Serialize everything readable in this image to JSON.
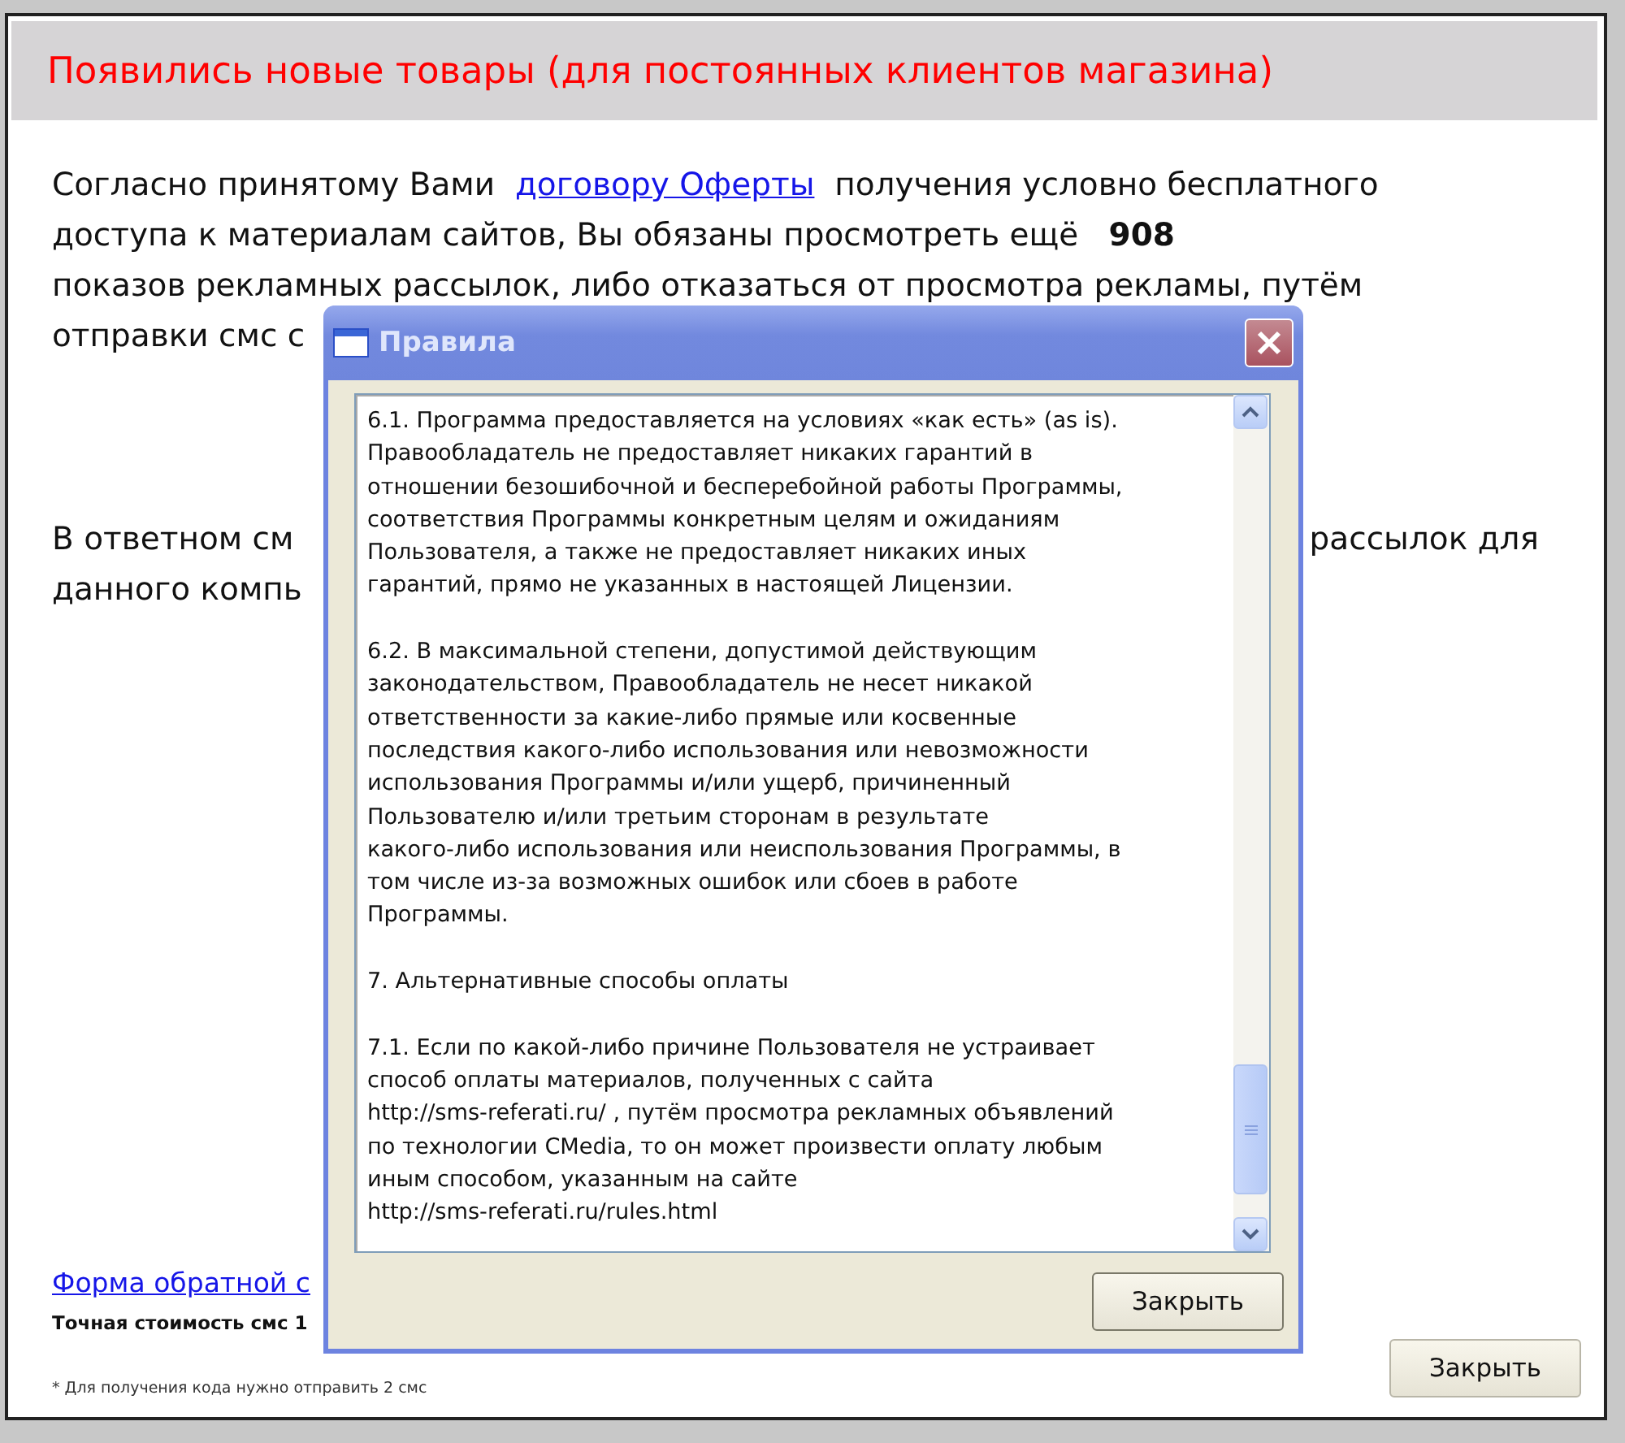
{
  "main_window": {
    "heading": "Появились новые товары (для постоянных клиентов магазина)",
    "offer": {
      "before": "Согласно принятому Вами",
      "link": "договору Оферты",
      "after": "получения условно бесплатного",
      "line2": "доступа к материалам сайтов, Вы обязаны просмотреть ещё",
      "count": "908",
      "line3": "показов рекламных рассылок, либо отказаться от просмотра рекламы, путём",
      "line4": "отправки смс с"
    },
    "reply": {
      "line1_left": "В ответном см",
      "line1_right": "рассылок для",
      "line2": "данного компь"
    },
    "feedback_link": "Форма обратной с",
    "price_note": "Точная стоимость смс 1",
    "footnote": "* Для получения кода нужно отправить 2 смс",
    "close_button": "Закрыть"
  },
  "dialog": {
    "title": "Правила",
    "paragraphs": [
      {
        "lines": [
          "6.1. Программа предоставляется на условиях «как есть» (as is).",
          "Правообладатель не предоставляет никаких гарантий в",
          "отношении безошибочной и бесперебойной работы Программы,",
          "соответствия Программы конкретным целям и ожиданиям",
          "Пользователя, а также не предоставляет никаких иных",
          "гарантий, прямо не указанных в настоящей Лицензии."
        ]
      },
      {
        "lines": [
          "6.2. В максимальной степени, допустимой действующим",
          "законодательством, Правообладатель не несет никакой",
          "ответственности за какие-либо прямые или косвенные",
          "последствия какого-либо использования или невозможности",
          "использования Программы и/или ущерб, причиненный",
          "Пользователю и/или третьим сторонам в результате",
          "какого-либо использования или неиспользования Программы, в",
          "том числе из-за возможных ошибок или сбоев в работе",
          "Программы."
        ]
      },
      {
        "lines": [
          "7. Альтернативные способы оплаты"
        ]
      },
      {
        "lines": [
          "7.1. Если по какой-либо причине Пользователя не устраивает",
          "способ оплаты материалов, полученных с сайта",
          "http://sms-referati.ru/ , путём просмотра рекламных объявлений",
          "по технологии CMedia, то он может произвести оплату любым",
          "иным способом, указанным на сайте",
          "http://sms-referati.ru/rules.html"
        ]
      }
    ],
    "close_button": "Закрыть"
  }
}
